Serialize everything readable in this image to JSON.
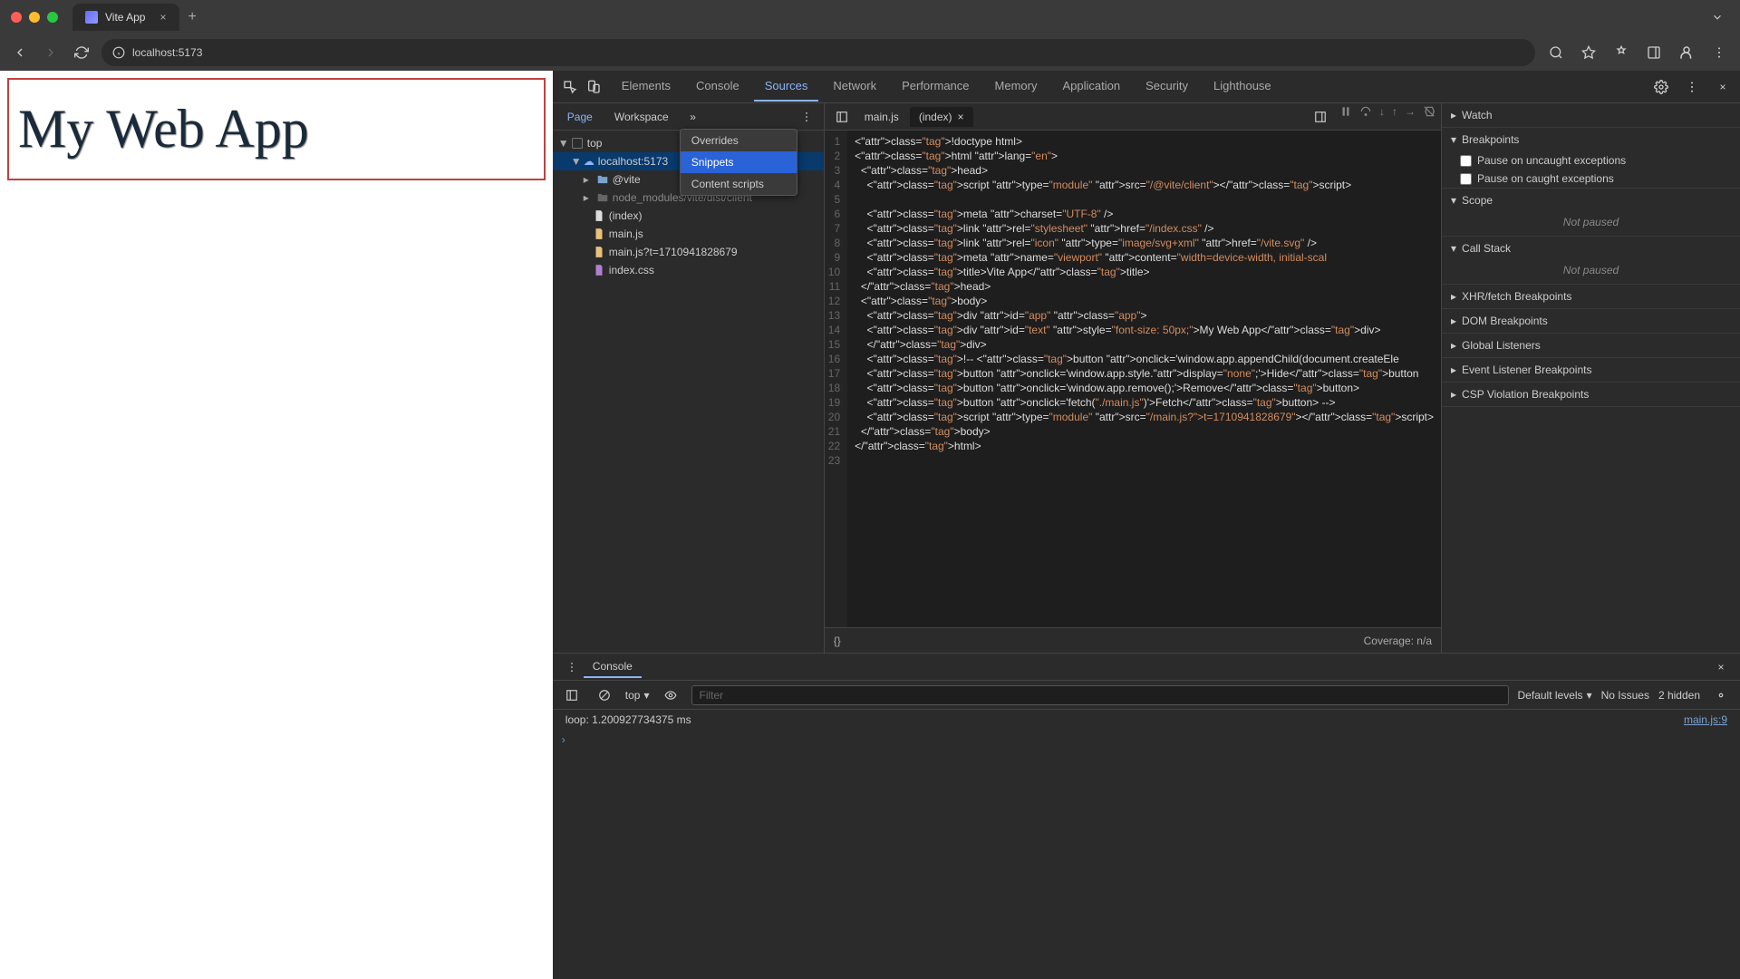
{
  "browser": {
    "tab_title": "Vite App",
    "url": "localhost:5173"
  },
  "page": {
    "heading": "My Web App"
  },
  "devtools": {
    "tabs": [
      "Elements",
      "Console",
      "Sources",
      "Network",
      "Performance",
      "Memory",
      "Application",
      "Security",
      "Lighthouse"
    ],
    "active_tab": "Sources",
    "subtabs": {
      "page": "Page",
      "workspace": "Workspace"
    },
    "overflow_menu": {
      "overrides": "Overrides",
      "snippets": "Snippets",
      "content_scripts": "Content scripts"
    }
  },
  "file_tree": {
    "top": "top",
    "host": "localhost:5173",
    "vite": "@vite",
    "node_modules": "node_modules/vite/dist/client",
    "index": "(index)",
    "mainjs": "main.js",
    "mainjs_ts": "main.js?t=1710941828679",
    "indexcss": "index.css"
  },
  "editor_tabs": {
    "mainjs": "main.js",
    "index": "(index)"
  },
  "code": [
    "<!doctype html>",
    "<html lang=\"en\">",
    "  <head>",
    "    <script type=\"module\" src=\"/@vite/client\"></script>",
    "",
    "    <meta charset=\"UTF-8\" />",
    "    <link rel=\"stylesheet\" href=\"/index.css\" />",
    "    <link rel=\"icon\" type=\"image/svg+xml\" href=\"/vite.svg\" />",
    "    <meta name=\"viewport\" content=\"width=device-width, initial-scal",
    "    <title>Vite App</title>",
    "  </head>",
    "  <body>",
    "    <div id=\"app\" class=\"app\">",
    "    <div id=\"text\" style=\"font-size: 50px;\">My Web App</div>",
    "    </div>",
    "    <!-- <button onclick='window.app.appendChild(document.createEle",
    "    <button onclick='window.app.style.display=\"none\";'>Hide</button",
    "    <button onclick='window.app.remove();'>Remove</button>",
    "    <button onclick='fetch(\"./main.js\")'>Fetch</button> -->",
    "    <script type=\"module\" src=\"/main.js?t=1710941828679\"></script>",
    "  </body>",
    "</html>",
    ""
  ],
  "coverage": {
    "braces": "{}",
    "label": "Coverage: n/a"
  },
  "debugger": {
    "watch": "Watch",
    "breakpoints": "Breakpoints",
    "pause_uncaught": "Pause on uncaught exceptions",
    "pause_caught": "Pause on caught exceptions",
    "scope": "Scope",
    "not_paused": "Not paused",
    "call_stack": "Call Stack",
    "xhr": "XHR/fetch Breakpoints",
    "dom": "DOM Breakpoints",
    "global": "Global Listeners",
    "event": "Event Listener Breakpoints",
    "csp": "CSP Violation Breakpoints"
  },
  "console": {
    "drawer_label": "Console",
    "context": "top",
    "filter_placeholder": "Filter",
    "levels": "Default levels",
    "no_issues": "No Issues",
    "hidden": "2 hidden",
    "log_msg": "loop: 1.200927734375 ms",
    "log_src": "main.js:9"
  }
}
